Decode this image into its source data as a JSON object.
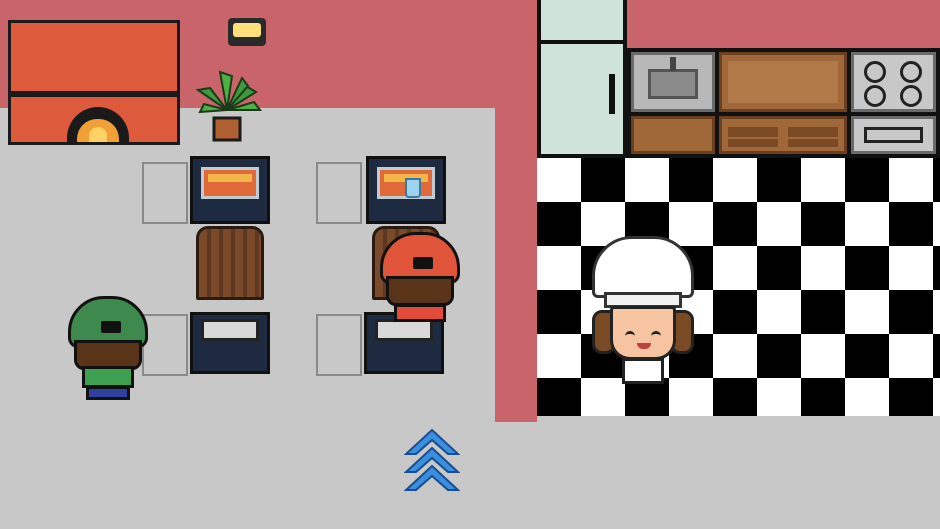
{
  "scene": {
    "type": "pizza restaurant (top-down pixel art)",
    "colors": {
      "wall": "#c8646a",
      "floor": "#c8c8c8",
      "accent_arrow": "#3a8fe0"
    }
  },
  "dining_room": {
    "furniture": [
      "pizza-oven",
      "wall-lamp",
      "potted-plant",
      "table-1",
      "table-2"
    ],
    "customers": [
      {
        "name": "customer-green-cap",
        "cap_color": "#3e8a4e",
        "shirt_color": "#3ea050"
      },
      {
        "name": "customer-red-cap",
        "cap_color": "#e0553a",
        "shirt_color": "#e24a3a"
      }
    ]
  },
  "kitchen": {
    "appliances": [
      "fridge",
      "sink",
      "counter",
      "drawers",
      "stove",
      "oven-door"
    ],
    "chef": {
      "name": "chef",
      "hat_color": "#ffffff"
    }
  },
  "controls": {
    "up_arrow_icon": "double-chevron-up-icon"
  }
}
